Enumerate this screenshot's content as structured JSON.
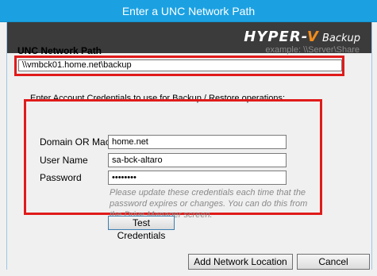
{
  "window": {
    "title": "Enter a UNC Network Path"
  },
  "brand": {
    "logo_main": "HYPER-",
    "logo_v": "V",
    "logo_sub": " Backup"
  },
  "unc": {
    "label": "UNC Network Path",
    "example": "example: \\\\Server\\Share",
    "value": "\\\\vmbck01.home.net\\backup"
  },
  "credentials": {
    "group_label": "Enter Account Credentials to use for Backup / Restore operations:",
    "domain_label": "Domain OR Machine",
    "domain_value": "home.net",
    "username_label": "User Name",
    "username_value": "sa-bck-altaro",
    "password_label": "Password",
    "password_value": "••••••••",
    "hint": "Please update these credentials each time that the password expires or changes. You can do this from the Drive Manager screen.",
    "test_button": "Test Credentials"
  },
  "footer": {
    "add_button": "Add Network Location",
    "cancel_button": "Cancel"
  },
  "colors": {
    "titlebar": "#1ba1e2",
    "highlight": "#e01b1b",
    "banner": "#3b3b3b",
    "logo_accent": "#f28c1b"
  }
}
